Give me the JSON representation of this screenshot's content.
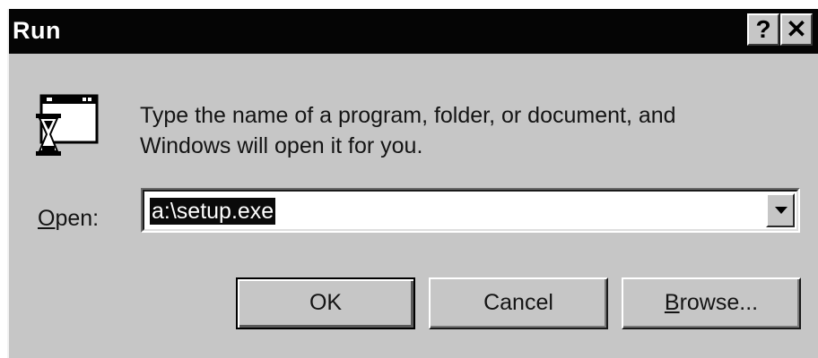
{
  "window": {
    "title": "Run",
    "help_label": "?",
    "close_label": "✕"
  },
  "icons": {
    "app_icon": "run-program-icon",
    "help": "question-mark-icon",
    "close": "close-icon",
    "dropdown": "chevron-down-icon"
  },
  "message": "Type the name of a program, folder, or document, and\nWindows will open it for you.",
  "open": {
    "label_underlined": "O",
    "label_rest": "pen:",
    "value": "a:\\setup.exe"
  },
  "buttons": {
    "ok": "OK",
    "cancel": "Cancel",
    "browse_underlined": "B",
    "browse_rest": "rowse..."
  },
  "colors": {
    "titlebar": "#050505",
    "face": "#c6c6c6",
    "selection": "#0a0a0a"
  }
}
